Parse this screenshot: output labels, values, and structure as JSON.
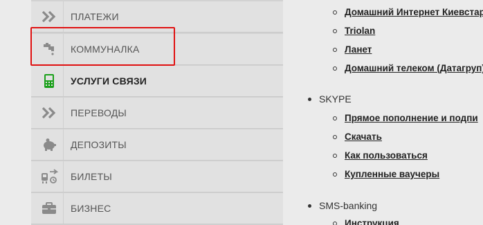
{
  "menu": {
    "items": [
      {
        "label": "ПЛАТЕЖИ",
        "icon": "double-chevron-icon"
      },
      {
        "label": "КОММУНАЛКА",
        "icon": "faucet-icon"
      },
      {
        "label": "УСЛУГИ СВЯЗИ",
        "icon": "phone-icon"
      },
      {
        "label": "ПЕРЕВОДЫ",
        "icon": "double-chevron-icon"
      },
      {
        "label": "ДЕПОЗИТЫ",
        "icon": "piggy-bank-icon"
      },
      {
        "label": "БИЛЕТЫ",
        "icon": "tickets-icon"
      },
      {
        "label": "БИЗНЕС",
        "icon": "briefcase-icon"
      }
    ],
    "active_index": 2,
    "active_color": "#1aa01a"
  },
  "content": {
    "links_top": [
      "Домашний Интернет Киевстар",
      "Triolan",
      "Ланет",
      "Домашний телеком (Датагруп)"
    ],
    "skype": {
      "label": "SKYPE",
      "links": [
        "Прямое пополнение и подпи",
        "Скачать",
        "Как пользоваться",
        "Купленные ваучеры"
      ]
    },
    "sms": {
      "label": "SMS-banking",
      "links": [
        "Инструкция"
      ]
    }
  },
  "colors": {
    "highlight": "#e01010",
    "icon_gray": "#8a8a8a"
  }
}
